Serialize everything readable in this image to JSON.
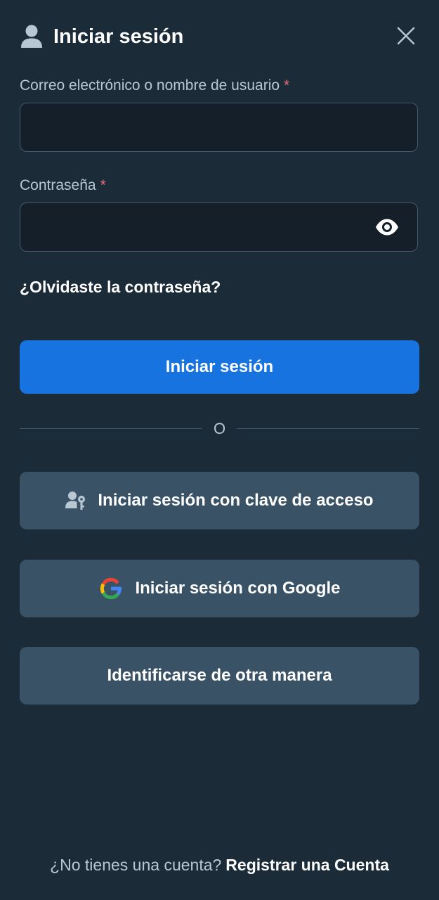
{
  "header": {
    "title": "Iniciar sesión",
    "icon": "user-icon",
    "close_icon": "close-icon"
  },
  "form": {
    "email": {
      "label": "Correo electrónico o nombre de usuario",
      "required_mark": "*",
      "value": ""
    },
    "password": {
      "label": "Contraseña",
      "required_mark": "*",
      "value": "",
      "toggle_icon": "eye-icon"
    },
    "forgot_password": "¿Olvidaste la contraseña?",
    "submit_label": "Iniciar sesión"
  },
  "divider": {
    "label": "O"
  },
  "alternatives": {
    "passkey_label": "Iniciar sesión con clave de acceso",
    "passkey_icon": "passkey-icon",
    "google_label": "Iniciar sesión con Google",
    "google_icon": "google-icon",
    "other_label": "Identificarse de otra manera"
  },
  "footer": {
    "prompt": "¿No tienes una cuenta?",
    "register_label": "Registrar una Cuenta"
  },
  "colors": {
    "background": "#1b2b38",
    "primary": "#1673e0",
    "secondary_button": "#3a5265",
    "input_background": "#141f29",
    "required": "#e8707a"
  }
}
